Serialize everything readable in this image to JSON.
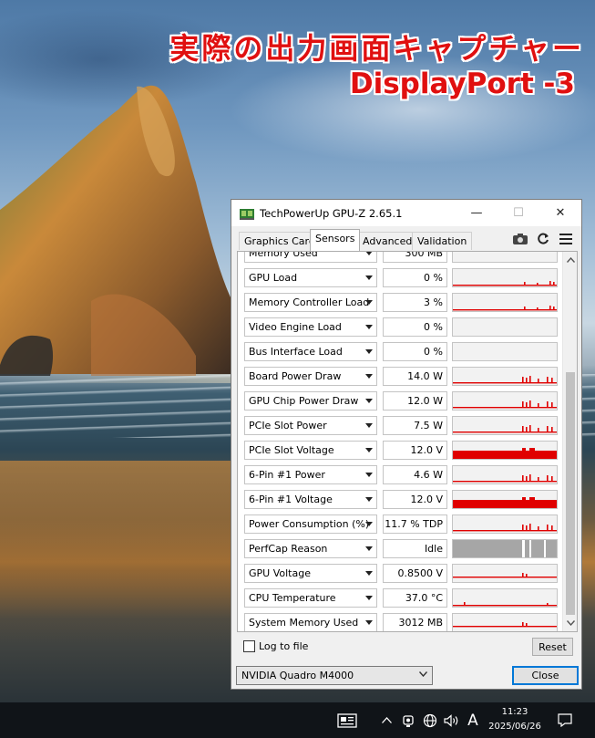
{
  "overlay": {
    "line1": "実際の出力画面キャプチャー",
    "line2": "DisplayPort -3"
  },
  "window": {
    "title": "TechPowerUp GPU-Z 2.65.1",
    "controls": {
      "minimize": "—",
      "maximize": "☐",
      "close": "✕"
    },
    "tabs": [
      {
        "label": "Graphics Card",
        "active": false
      },
      {
        "label": "Sensors",
        "active": true
      },
      {
        "label": "Advanced",
        "active": false
      },
      {
        "label": "Validation",
        "active": false
      }
    ],
    "toolbar_icons": [
      "camera-icon",
      "refresh-icon",
      "menu-icon"
    ]
  },
  "sensors": [
    {
      "label": "Memory Used",
      "value": "300 MB",
      "graph": "partial-top"
    },
    {
      "label": "GPU Load",
      "value": "0 %",
      "graph": "low-spikes"
    },
    {
      "label": "Memory Controller Load",
      "value": "3 %",
      "graph": "low-spikes"
    },
    {
      "label": "Video Engine Load",
      "value": "0 %",
      "graph": "flat"
    },
    {
      "label": "Bus Interface Load",
      "value": "0 %",
      "graph": "flat"
    },
    {
      "label": "Board Power Draw",
      "value": "14.0 W",
      "graph": "mid-spikes"
    },
    {
      "label": "GPU Chip Power Draw",
      "value": "12.0 W",
      "graph": "mid-spikes"
    },
    {
      "label": "PCIe Slot Power",
      "value": "7.5 W",
      "graph": "mid-spikes"
    },
    {
      "label": "PCIe Slot Voltage",
      "value": "12.0 V",
      "graph": "full-bar"
    },
    {
      "label": "6-Pin #1 Power",
      "value": "4.6 W",
      "graph": "mid-spikes"
    },
    {
      "label": "6-Pin #1 Voltage",
      "value": "12.0 V",
      "graph": "full-bar"
    },
    {
      "label": "Power Consumption (%)",
      "value": "11.7 % TDP",
      "graph": "mid-spikes"
    },
    {
      "label": "PerfCap Reason",
      "value": "Idle",
      "graph": "gray-idle"
    },
    {
      "label": "GPU Voltage",
      "value": "0.8500 V",
      "graph": "mid-line"
    },
    {
      "label": "CPU Temperature",
      "value": "37.0 °C",
      "graph": "low-line"
    },
    {
      "label": "System Memory Used",
      "value": "3012 MB",
      "graph": "mid-line"
    }
  ],
  "footer": {
    "log_label": "Log to file",
    "log_checked": false,
    "reset_label": "Reset",
    "gpu_selected": "NVIDIA Quadro M4000",
    "close_label": "Close"
  },
  "taskbar": {
    "ime": "A",
    "time": "11:23",
    "date": "2025/06/26"
  },
  "colors": {
    "graph_red": "#e00000",
    "perfcap_gray": "#a6a6a6",
    "overlay_red": "#e01010",
    "focus_blue": "#0078d7"
  }
}
